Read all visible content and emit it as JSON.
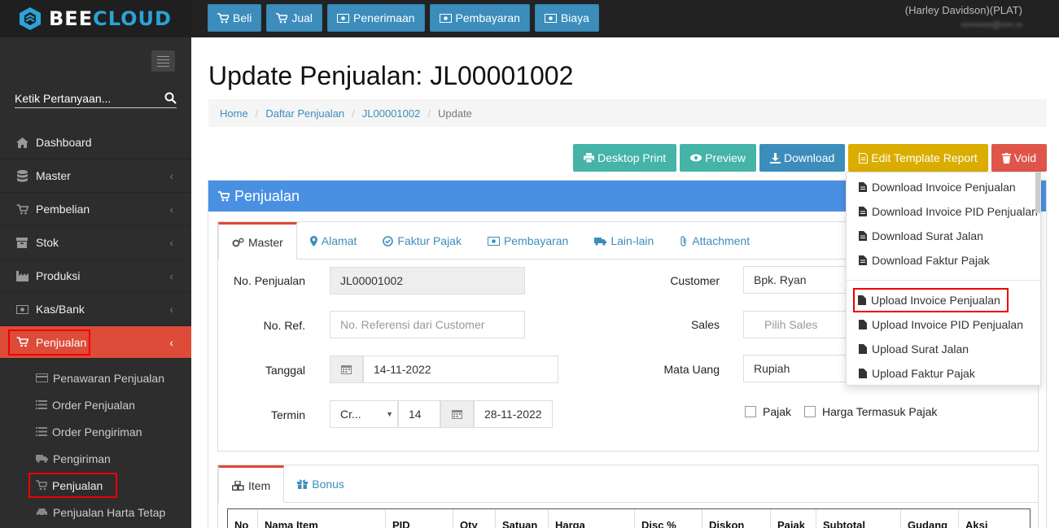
{
  "app": {
    "brand_a": "BEE",
    "brand_b": "CLOUD"
  },
  "topnav": [
    {
      "label": "Beli",
      "icon": "cart-icon"
    },
    {
      "label": "Jual",
      "icon": "cart-icon"
    },
    {
      "label": "Penerimaan",
      "icon": "money-icon"
    },
    {
      "label": "Pembayaran",
      "icon": "money-icon"
    },
    {
      "label": "Biaya",
      "icon": "money-icon"
    }
  ],
  "user": {
    "company": "(Harley Davidson)(PLAT)",
    "email": "••••••••••@••••.••"
  },
  "sidebar": {
    "search_placeholder": "Ketik Pertanyaan...",
    "items": [
      {
        "label": "Dashboard",
        "icon": "home-icon"
      },
      {
        "label": "Master",
        "icon": "database-icon"
      },
      {
        "label": "Pembelian",
        "icon": "cart-icon"
      },
      {
        "label": "Stok",
        "icon": "box-icon"
      },
      {
        "label": "Produksi",
        "icon": "factory-icon"
      },
      {
        "label": "Kas/Bank",
        "icon": "money-icon"
      },
      {
        "label": "Penjualan",
        "icon": "cart-icon"
      }
    ],
    "sub_items": [
      {
        "label": "Penawaran Penjualan"
      },
      {
        "label": "Order Penjualan"
      },
      {
        "label": "Order Pengiriman"
      },
      {
        "label": "Pengiriman"
      },
      {
        "label": "Penjualan"
      },
      {
        "label": "Penjualan Harta Tetap"
      }
    ]
  },
  "page": {
    "title": "Update Penjualan: JL00001002",
    "breadcrumb": [
      "Home",
      "Daftar Penjualan",
      "JL00001002",
      "Update"
    ]
  },
  "actions": {
    "desktop_print": "Desktop Print",
    "preview": "Preview",
    "download": "Download",
    "edit_template": "Edit Template Report",
    "void": "Void"
  },
  "panel": {
    "title": "Penjualan"
  },
  "tabs": [
    "Master",
    "Alamat",
    "Faktur Pajak",
    "Pembayaran",
    "Lain-lain",
    "Attachment"
  ],
  "form": {
    "no_penjualan_label": "No. Penjualan",
    "no_penjualan_value": "JL00001002",
    "no_ref_label": "No. Ref.",
    "no_ref_placeholder": "No. Referensi dari Customer",
    "tanggal_label": "Tanggal",
    "tanggal_value": "14-11-2022",
    "termin_label": "Termin",
    "termin_type": "Cr...",
    "termin_days": "14",
    "termin_date": "28-11-2022",
    "customer_label": "Customer",
    "customer_value": "Bpk. Ryan",
    "sales_label": "Sales",
    "sales_placeholder": "Pilih Sales",
    "mata_uang_label": "Mata Uang",
    "mata_uang_value": "Rupiah",
    "pajak_label": "Pajak",
    "harga_pajak_label": "Harga Termasuk Pajak"
  },
  "item_tabs": [
    "Item",
    "Bonus"
  ],
  "table_headers": [
    "No",
    "Nama Item",
    "PID",
    "Qty",
    "Satuan",
    "Harga",
    "Disc %",
    "Diskon",
    "Pajak",
    "Subtotal",
    "Gudang",
    "Aksi"
  ],
  "dropdown": [
    "Download Invoice Penjualan",
    "Download Invoice PID Penjualan",
    "Download Surat Jalan",
    "Download Faktur Pajak",
    "Upload Invoice Penjualan",
    "Upload Invoice PID Penjualan",
    "Upload Surat Jalan",
    "Upload Faktur Pajak"
  ]
}
